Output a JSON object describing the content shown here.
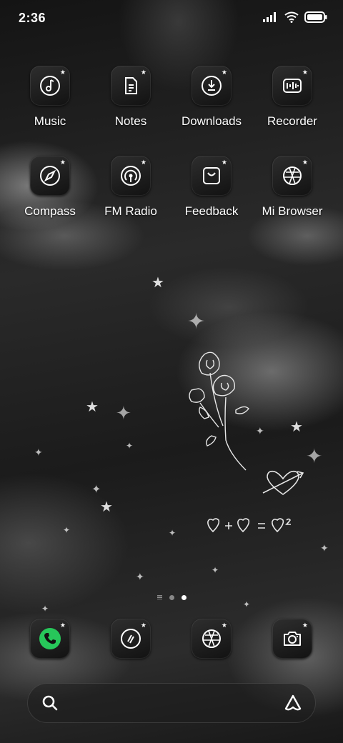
{
  "status_bar": {
    "time": "2:36"
  },
  "apps_row1": [
    {
      "label": "Music",
      "icon": "music-note-icon"
    },
    {
      "label": "Notes",
      "icon": "notes-icon"
    },
    {
      "label": "Downloads",
      "icon": "download-icon"
    },
    {
      "label": "Recorder",
      "icon": "recorder-icon"
    }
  ],
  "apps_row2": [
    {
      "label": "Compass",
      "icon": "compass-icon"
    },
    {
      "label": "FM Radio",
      "icon": "radio-icon"
    },
    {
      "label": "Feedback",
      "icon": "feedback-icon"
    },
    {
      "label": "Mi Browser",
      "icon": "browser-globe-icon"
    }
  ],
  "dock": [
    {
      "icon": "phone-icon",
      "color": "#27c75a"
    },
    {
      "icon": "messages-icon"
    },
    {
      "icon": "browser-globe-icon"
    },
    {
      "icon": "camera-icon"
    }
  ],
  "page_indicator": {
    "pages": 2,
    "current": 2
  },
  "search_bar": {
    "left_icon": "search-icon",
    "right_icon": "assistant-icon"
  },
  "wallpaper": {
    "theme": "dark clouds with rose drawing and sparkles"
  }
}
